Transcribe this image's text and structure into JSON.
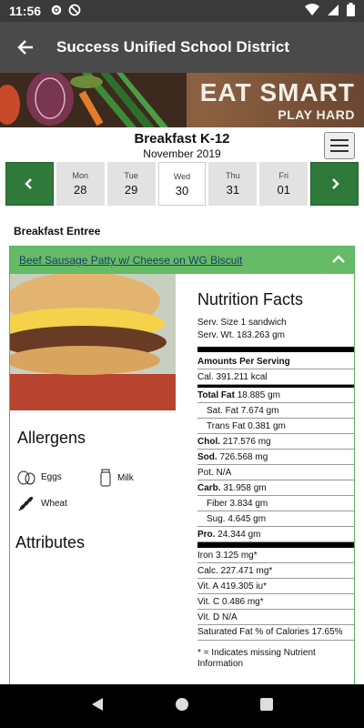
{
  "status": {
    "time": "11:56"
  },
  "app": {
    "title": "Success Unified School District"
  },
  "banner": {
    "line1": "EAT SMART",
    "line2": "PLAY HARD"
  },
  "menu": {
    "meal": "Breakfast K-12",
    "month": "November 2019"
  },
  "days": [
    {
      "name": "Mon",
      "date": "28"
    },
    {
      "name": "Tue",
      "date": "29"
    },
    {
      "name": "Wed",
      "date": "30"
    },
    {
      "name": "Thu",
      "date": "31"
    },
    {
      "name": "Fri",
      "date": "01"
    }
  ],
  "section": {
    "title": "Breakfast Entree"
  },
  "item": {
    "name": "Beef Sausage Patty w/ Cheese on WG Biscuit"
  },
  "allergens": {
    "title": "Allergens",
    "list": [
      "Eggs",
      "Milk",
      "Wheat"
    ]
  },
  "attributes": {
    "title": "Attributes"
  },
  "nutrition": {
    "title": "Nutrition Facts",
    "serv_size": "Serv. Size 1 sandwich",
    "serv_wt": "Serv. Wt. 183.263 gm",
    "amounts": "Amounts Per Serving",
    "cal": "Cal. 391.211 kcal",
    "total_fat_label": "Total Fat",
    "total_fat": "18.885 gm",
    "sat_fat": "Sat. Fat 7.674 gm",
    "trans_fat": "Trans Fat 0.381 gm",
    "chol_label": "Chol.",
    "chol": "217.576 mg",
    "sod_label": "Sod.",
    "sod": "726.568 mg",
    "pot": "Pot. N/A",
    "carb_label": "Carb.",
    "carb": "31.958 gm",
    "fiber": "Fiber 3.834 gm",
    "sug": "Sug. 4.645 gm",
    "pro_label": "Pro.",
    "pro": "24.344 gm",
    "iron": "Iron 3.125 mg*",
    "calc": "Calc. 227.471 mg*",
    "vita": "Vit. A 419.305 iu*",
    "vitc": "Vit. C 0.486 mg*",
    "vitd": "Vit. D N/A",
    "satfat_pct": "Saturated Fat % of Calories 17.65%",
    "note": "* = Indicates missing Nutrient Information"
  }
}
